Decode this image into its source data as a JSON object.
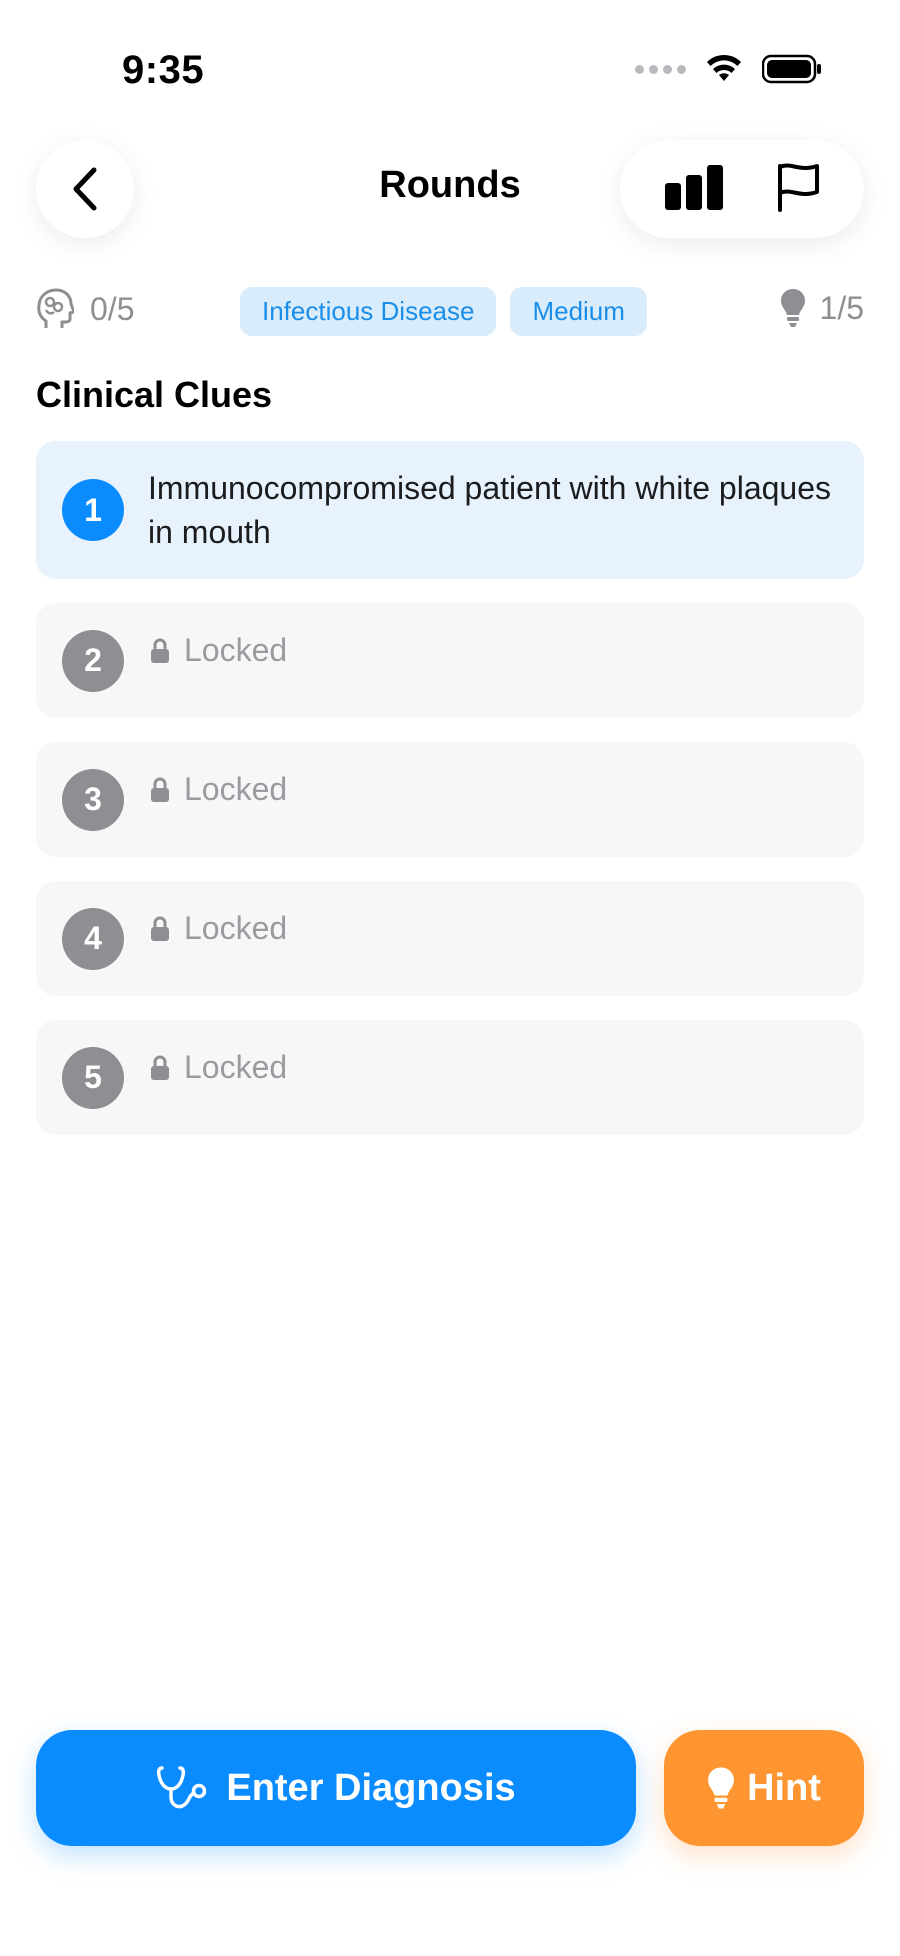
{
  "status_bar": {
    "time": "9:35"
  },
  "nav": {
    "title": "Rounds"
  },
  "meta": {
    "solved_count": "0/5",
    "tags": [
      "Infectious Disease",
      "Medium"
    ],
    "hints_count": "1/5"
  },
  "section": {
    "title": "Clinical Clues"
  },
  "clues": [
    {
      "number": "1",
      "text": "Immunocompromised patient with white plaques in mouth",
      "locked": false
    },
    {
      "number": "2",
      "text": "Locked",
      "locked": true
    },
    {
      "number": "3",
      "text": "Locked",
      "locked": true
    },
    {
      "number": "4",
      "text": "Locked",
      "locked": true
    },
    {
      "number": "5",
      "text": "Locked",
      "locked": true
    }
  ],
  "actions": {
    "diagnose_label": "Enter Diagnosis",
    "hint_label": "Hint"
  },
  "colors": {
    "accent": "#0a8cff",
    "hint": "#ff9530",
    "tag_bg": "#d9ecfb",
    "tag_text": "#1a8ee8"
  },
  "icons": {
    "back": "chevron-left-icon",
    "stats": "bar-chart-icon",
    "flag": "flag-icon",
    "brain": "brain-head-icon",
    "bulb": "lightbulb-icon",
    "lock": "lock-icon",
    "stethoscope": "stethoscope-icon"
  }
}
